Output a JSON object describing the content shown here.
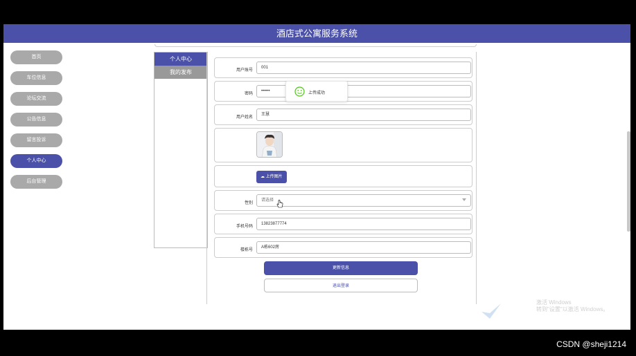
{
  "header": {
    "title": "酒店式公寓服务系统"
  },
  "sidebar": {
    "items": [
      {
        "label": "首页"
      },
      {
        "label": "车位信息"
      },
      {
        "label": "论坛交流"
      },
      {
        "label": "公告信息"
      },
      {
        "label": "留言投诉"
      },
      {
        "label": "个人中心",
        "active": true
      },
      {
        "label": "后台管理"
      }
    ]
  },
  "menu": {
    "items": [
      {
        "label": "个人中心",
        "active": true
      },
      {
        "label": "我的发布"
      }
    ]
  },
  "form": {
    "account": {
      "label": "用户账号",
      "value": "001"
    },
    "password": {
      "label": "密码",
      "value": "••••••"
    },
    "name": {
      "label": "用户姓名",
      "value": "王慧"
    },
    "upload_label": "上传图片",
    "gender": {
      "label": "性别",
      "placeholder": "请选择"
    },
    "phone": {
      "label": "手机号码",
      "value": "13823877774"
    },
    "room": {
      "label": "楼栋号",
      "value": "A栋602房"
    }
  },
  "buttons": {
    "update": "更新信息",
    "logout": "退出登录"
  },
  "toast": {
    "text": "上传成功"
  },
  "watermark": {
    "line1": "激活 Windows",
    "line2": "转到\"设置\"以激活 Windows。"
  },
  "credit": "CSDN @sheji1214",
  "colors": {
    "brand": "#4b51a8",
    "inactive": "#a9a9a9",
    "success": "#52c41a"
  }
}
